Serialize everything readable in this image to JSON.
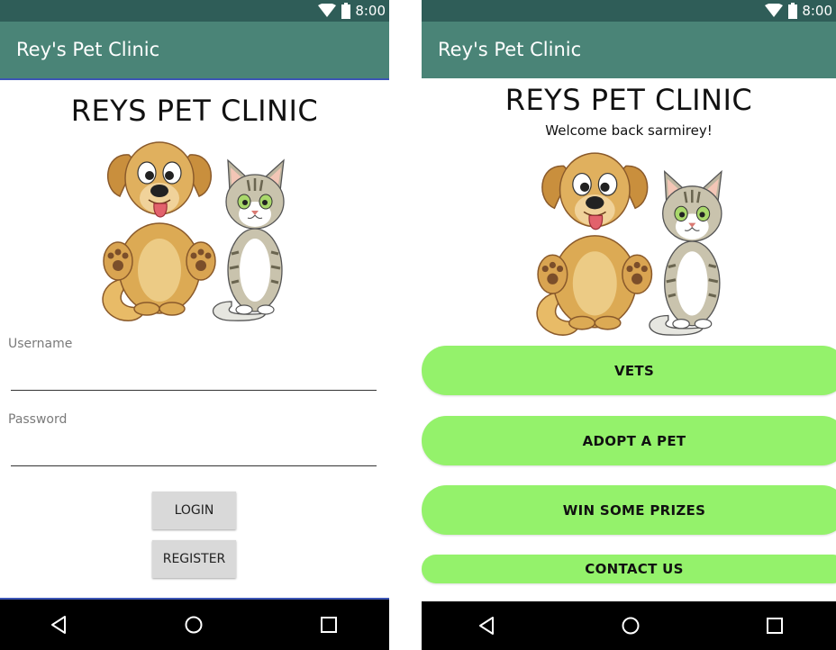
{
  "left_screen": {
    "status_bar": {
      "time": "8:00"
    },
    "app_bar": {
      "title": "Rey's Pet Clinic"
    },
    "heading": "REYS PET CLINIC",
    "form": {
      "username_label": "Username",
      "username_value": "",
      "password_label": "Password",
      "password_value": ""
    },
    "buttons": {
      "login": "LOGIN",
      "register": "REGISTER"
    }
  },
  "right_screen": {
    "status_bar": {
      "time": "8:00"
    },
    "app_bar": {
      "title": "Rey's Pet Clinic"
    },
    "heading": "REYS PET CLINIC",
    "welcome": "Welcome back sarmirey!",
    "menu": [
      {
        "label": "VETS"
      },
      {
        "label": "ADOPT A PET"
      },
      {
        "label": "WIN SOME PRIZES"
      },
      {
        "label": "CONTACT US"
      }
    ]
  },
  "icons": {
    "status": [
      "wifi-icon",
      "battery-icon"
    ],
    "nav": [
      "back-icon",
      "home-icon",
      "recents-icon"
    ],
    "illustration": "dog-and-cat-illustration"
  },
  "colors": {
    "status_bar": "#2f5d58",
    "app_bar": "#4a8477",
    "accent_line": "#3c55b5",
    "menu_button": "#94f26b",
    "gray_button": "#d9d9d9",
    "nav_bar": "#000000"
  }
}
